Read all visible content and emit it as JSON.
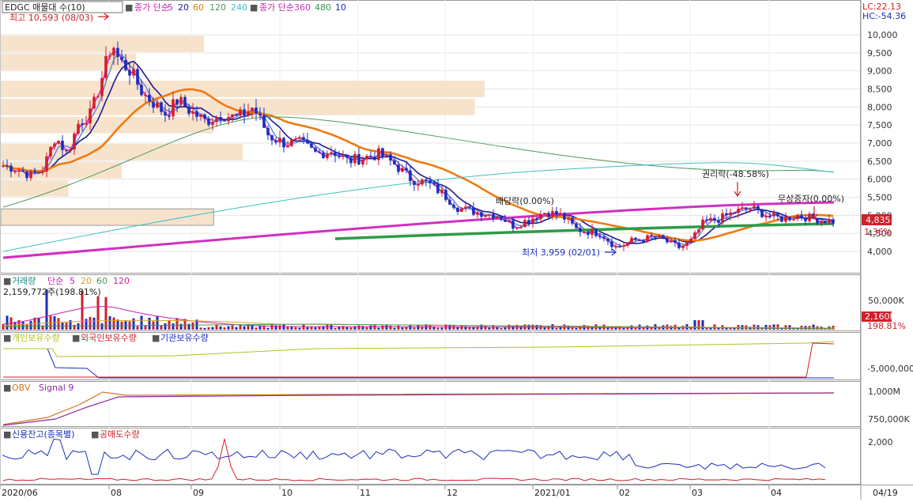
{
  "top_legend": {
    "box_label": "EDGC 매물대 수(10)",
    "ma_group1_label": "종가 단순",
    "ma_group1_periods": [
      "5",
      "20",
      "60",
      "120",
      "240"
    ],
    "ma_group2_label": "종가 단순",
    "ma_group2_periods": [
      "360",
      "480",
      "10"
    ],
    "lc": "LC:22.13",
    "hc": "HC:-54.36"
  },
  "colors": {
    "up": "#d0202a",
    "down": "#1a2fbf",
    "ma5": "#e020c0",
    "ma10": "#1b1b9a",
    "ma20": "#5b86d8",
    "ma60": "#f07a10",
    "ma120": "#4c9a5a",
    "ma240": "#3cc0c4",
    "ma360": "#d030c0",
    "ma480": "#2e9a4a",
    "volume_profile": "#f7e3cc",
    "grid": "#e6e6e6"
  },
  "annotations": {
    "high": "최고 10,593 (08/03)",
    "low": "최저 3,959 (02/01)",
    "dividend": "배당락(0.00%)",
    "rights": "권리락(-48.58%)",
    "bonus": "무상증자(0.00%)",
    "last_price_tag": "4,835",
    "last_pct_tag": "1.36%"
  },
  "volume_panel": {
    "legend_label": "거래량",
    "ma_label": "단순",
    "periods": [
      "5",
      "20",
      "60",
      "120"
    ],
    "current_value": "2,159,772주(198.81%)",
    "tick_label": "50,000K",
    "last_value_tag": "2,160K",
    "last_pct_tag": "198.81%"
  },
  "holdings_panel": {
    "series1": "개인보유수량",
    "series2": "외국인보유수량",
    "series3": "기관보유수량",
    "tick_label": "-5,000,000"
  },
  "obv_panel": {
    "series1": "OBV",
    "series2": "Signal 9",
    "tick_labels": [
      "1,000M",
      "750,000K"
    ]
  },
  "credit_panel": {
    "series1": "신용잔고(종목별)",
    "series2": "공매도수량",
    "tick_label": "2,000"
  },
  "x_axis": {
    "labels": [
      "2020/06",
      "08",
      "09",
      "10",
      "11",
      "12",
      "2021/01",
      "02",
      "03",
      "04"
    ],
    "right_label": "04/19"
  },
  "chart_data": [
    {
      "type": "candlestick",
      "title": "EDGC",
      "y_ticks": [
        4000,
        4500,
        5000,
        5500,
        6000,
        6500,
        7000,
        7500,
        8000,
        8500,
        9000,
        9500,
        10000
      ],
      "ylim": [
        3550,
        10950
      ],
      "x_labels": [
        "2020/06",
        "08",
        "09",
        "10",
        "11",
        "12",
        "2021/01",
        "02",
        "03",
        "04"
      ],
      "high": {
        "date": "08/03",
        "value": 10593
      },
      "low": {
        "date": "02/01",
        "value": 3959
      },
      "last_close": 4835,
      "last_change_pct": 1.36,
      "moving_averages": [
        "5",
        "20",
        "60",
        "120",
        "240",
        "360",
        "480",
        "10"
      ],
      "volume_profile_levels": [
        {
          "price": 9750,
          "rel": 0.42
        },
        {
          "price": 9250,
          "rel": 0.28
        },
        {
          "price": 8500,
          "rel": 1.0
        },
        {
          "price": 8000,
          "rel": 0.98
        },
        {
          "price": 7500,
          "rel": 0.44
        },
        {
          "price": 6750,
          "rel": 0.5
        },
        {
          "price": 6250,
          "rel": 0.25
        },
        {
          "price": 5750,
          "rel": 0.14
        },
        {
          "price": 4950,
          "rel": 0.44
        }
      ],
      "events": [
        {
          "label": "배당락(0.00%)",
          "date": "12월 말"
        },
        {
          "label": "권리락(-48.58%)",
          "date": "03월"
        },
        {
          "label": "무상증자(0.00%)",
          "date": "04월"
        }
      ],
      "right_axis": {
        "lc": 22.13,
        "hc": -54.36
      }
    },
    {
      "type": "bar",
      "title": "거래량",
      "current_volume_shares": 2159772,
      "current_volume_pct": 198.81,
      "y_tick": "50,000K",
      "last_tag": "2,160K"
    },
    {
      "type": "line",
      "title": "보유수량",
      "series": [
        {
          "name": "개인보유수량"
        },
        {
          "name": "외국인보유수량"
        },
        {
          "name": "기관보유수량"
        }
      ],
      "y_tick": "-5,000,000"
    },
    {
      "type": "line",
      "title": "OBV",
      "series": [
        {
          "name": "OBV"
        },
        {
          "name": "Signal 9"
        }
      ],
      "y_ticks": [
        "1,000M",
        "750,000K"
      ]
    },
    {
      "type": "line",
      "title": "신용잔고",
      "series": [
        {
          "name": "신용잔고(종목별)"
        },
        {
          "name": "공매도수량"
        }
      ],
      "y_tick": "2,000"
    }
  ]
}
